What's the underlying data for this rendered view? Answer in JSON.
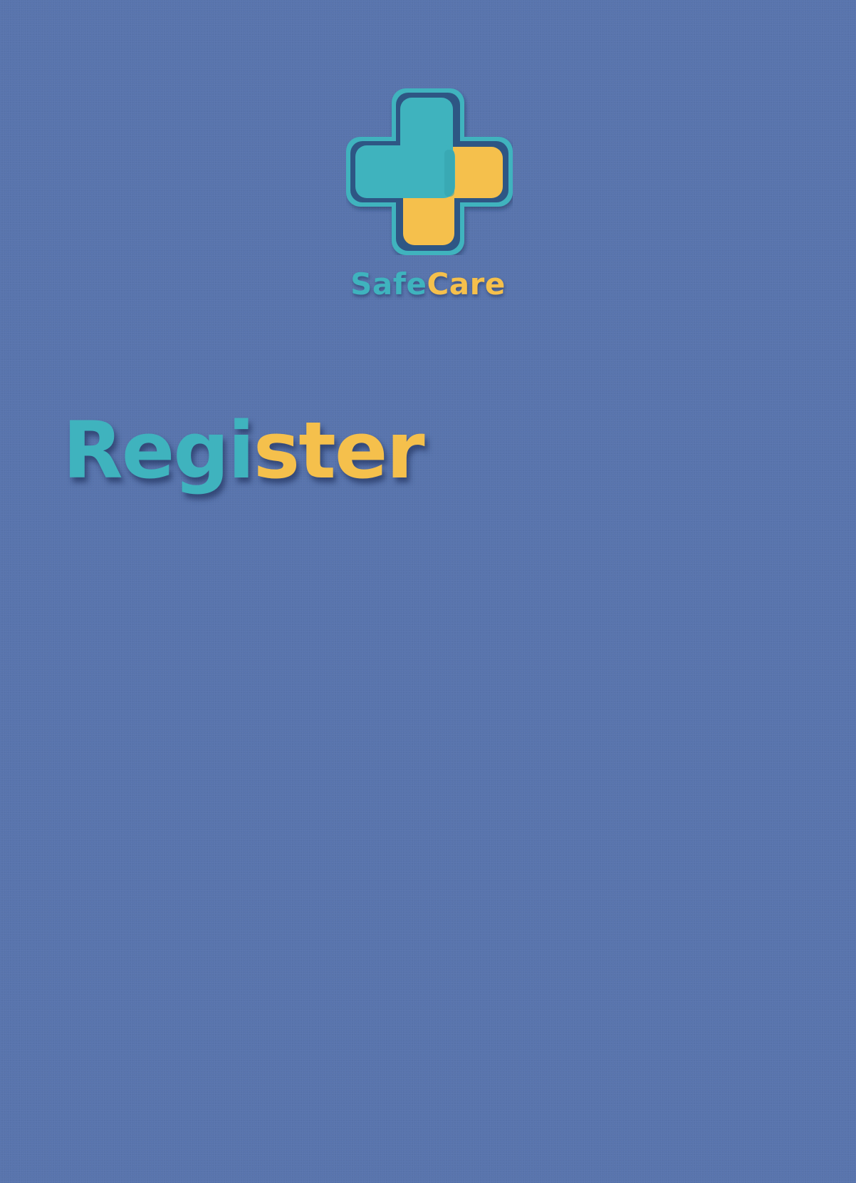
{
  "brand": {
    "name_part1": "Safe",
    "name_part2": "Care",
    "logo_icon": "medical-cross-icon",
    "colors": {
      "teal": "#3fb3be",
      "yellow": "#f5c04c",
      "outline": "#2f5784",
      "background": "#5874ad"
    }
  },
  "page": {
    "title_part1": "Regi",
    "title_part2": "ster"
  }
}
